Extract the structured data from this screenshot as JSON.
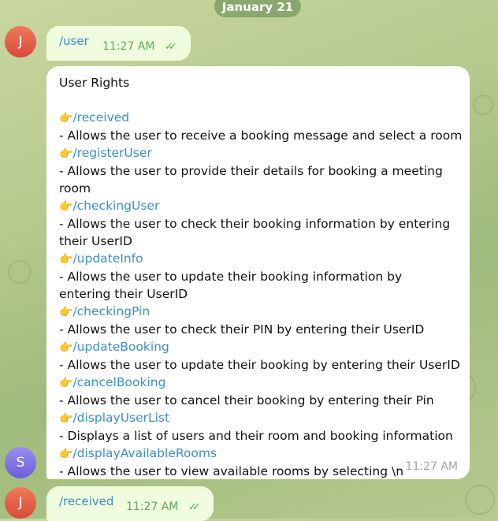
{
  "date_label": "January 21",
  "avatars": {
    "j_initial": "J",
    "s_initial": "S"
  },
  "messages": [
    {
      "command": "/user",
      "time": "11:27 AM",
      "ticks": "✓✓"
    },
    {
      "command": "/received",
      "time": "11:27 AM",
      "ticks": "✓✓"
    }
  ],
  "reply": {
    "title": "User Rights",
    "pointer_emoji": "👉",
    "time": "11:27 AM",
    "items": [
      {
        "command": "/received",
        "description": " - Allows the user to receive a booking message and select a room"
      },
      {
        "command": "/registerUser",
        "description": "  - Allows the user to provide their details for booking a meeting room"
      },
      {
        "command": "/checkingUser",
        "description": "  - Allows the user to check their booking information by entering their UserID"
      },
      {
        "command": "/updateInfo",
        "description": "  - Allows the user to update their booking information by entering their UserID"
      },
      {
        "command": "/checkingPin",
        "description": "  - Allows the user to check their PIN by entering their UserID"
      },
      {
        "command": "/updateBooking",
        "description": " - Allows the user to update their booking by entering their UserID"
      },
      {
        "command": "/cancelBooking",
        "description": " - Allows the user to cancel their booking by entering their Pin"
      },
      {
        "command": "/displayUserList",
        "description": " - Displays a list of users and their room and booking information"
      },
      {
        "command": "/displayAvailableRooms",
        "description": " - Allows the user to view available rooms by selecting \\n"
      }
    ]
  },
  "colors": {
    "link": "#3a8fc8",
    "outgoing_bubble": "#effdde",
    "incoming_bubble": "#ffffff",
    "read_ticks": "#5fab5e",
    "date_pill": "#8aa86e"
  }
}
